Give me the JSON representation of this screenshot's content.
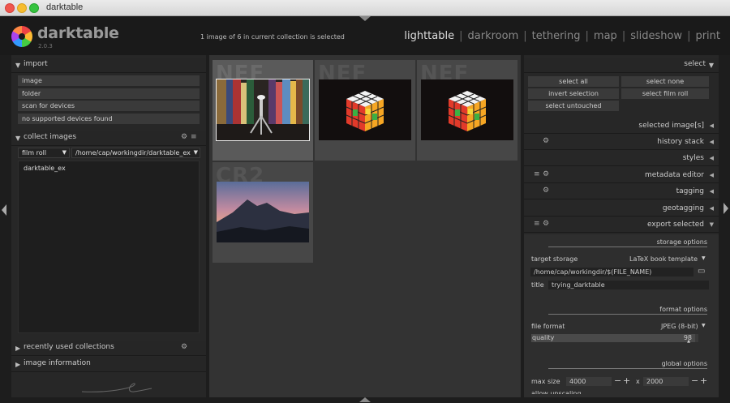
{
  "window": {
    "title": "darktable"
  },
  "header": {
    "app_name": "darktable",
    "version": "2.0.3",
    "status": "1 image of 6 in current collection is selected",
    "views": [
      "lighttable",
      "darkroom",
      "tethering",
      "map",
      "slideshow",
      "print"
    ],
    "active_view": "lighttable"
  },
  "left": {
    "import": {
      "title": "import",
      "buttons": [
        "image",
        "folder",
        "scan for devices",
        "no supported devices found"
      ]
    },
    "collect": {
      "title": "collect images",
      "property": "film roll",
      "path": "/home/cap/workingdir/darktable_ex",
      "items": [
        "darktable_ex"
      ]
    },
    "recent": {
      "title": "recently used collections"
    },
    "info": {
      "title": "image information"
    }
  },
  "center": {
    "thumbs": [
      {
        "label": "NEF",
        "subject": "books-tripod",
        "selected": true
      },
      {
        "label": "NEF",
        "subject": "rubiks-cube",
        "selected": false
      },
      {
        "label": "NEF",
        "subject": "rubiks-cube",
        "selected": false
      },
      {
        "label": "CR2",
        "subject": "mountain-sunset",
        "selected": false
      }
    ]
  },
  "right": {
    "select": {
      "title": "select",
      "buttons": [
        "select all",
        "select none",
        "invert selection",
        "select film roll",
        "select untouched"
      ]
    },
    "modules": [
      {
        "name": "selected image[s]",
        "icons": []
      },
      {
        "name": "history stack",
        "icons": [
          "gear-icon"
        ]
      },
      {
        "name": "styles",
        "icons": []
      },
      {
        "name": "metadata editor",
        "icons": [
          "menu-icon",
          "gear-icon"
        ]
      },
      {
        "name": "tagging",
        "icons": [
          "gear-icon"
        ]
      },
      {
        "name": "geotagging",
        "icons": []
      }
    ],
    "export": {
      "title": "export selected",
      "storage_header": "storage options",
      "target_storage_label": "target storage",
      "target_storage_value": "LaTeX book template",
      "path": "/home/cap/workingdir/$(FILE_NAME)",
      "title_label": "title",
      "title_value": "trying_darktable",
      "format_header": "format options",
      "file_format_label": "file format",
      "file_format_value": "JPEG (8-bit)",
      "quality_label": "quality",
      "quality_value": "98",
      "quality": 98,
      "global_header": "global options",
      "max_size_label": "max size",
      "max_w": "4000",
      "max_x": "x",
      "max_h": "2000",
      "allow_upscaling_label": "allow upscaling"
    }
  },
  "colors": {
    "panel": "#272727",
    "center": "#333333",
    "header": "#1a1a1a"
  }
}
